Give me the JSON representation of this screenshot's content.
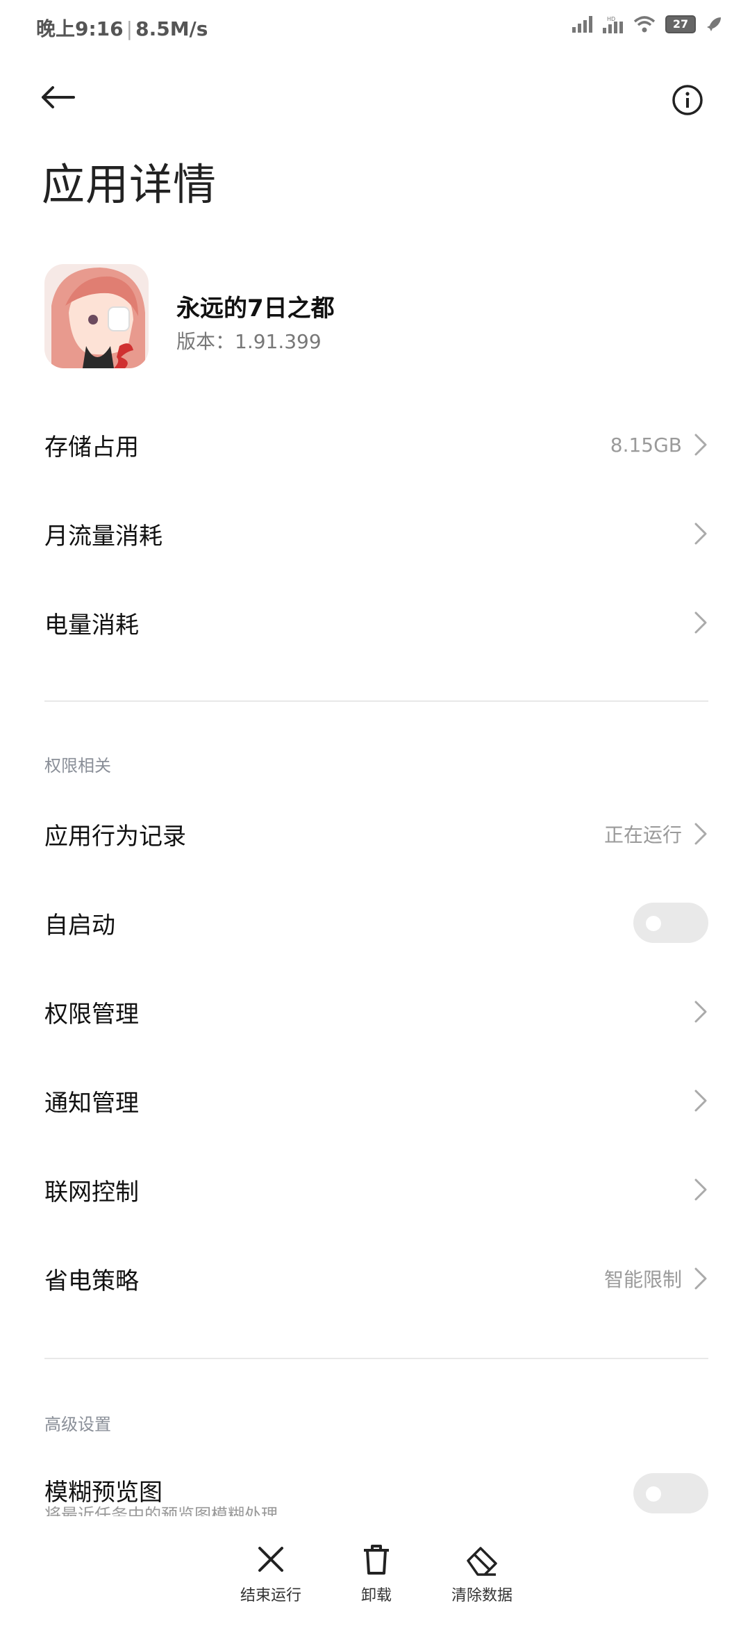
{
  "status_bar": {
    "time": "晚上9:16",
    "speed": "8.5M/s",
    "battery": "27"
  },
  "header": {
    "title": "应用详情"
  },
  "app": {
    "name": "永远的7日之都",
    "version": "版本：1.91.399"
  },
  "usage": [
    {
      "label": "存储占用",
      "value": "8.15GB"
    },
    {
      "label": "月流量消耗",
      "value": ""
    },
    {
      "label": "电量消耗",
      "value": ""
    }
  ],
  "permissions_section": {
    "title": "权限相关",
    "items": [
      {
        "label": "应用行为记录",
        "value": "正在运行"
      },
      {
        "label": "自启动",
        "toggle": false
      },
      {
        "label": "权限管理",
        "value": ""
      },
      {
        "label": "通知管理",
        "value": ""
      },
      {
        "label": "联网控制",
        "value": ""
      },
      {
        "label": "省电策略",
        "value": "智能限制"
      }
    ]
  },
  "advanced_section": {
    "title": "高级设置",
    "items": [
      {
        "label": "模糊预览图",
        "sub": "将最近任务中的预览图模糊处理",
        "toggle": false
      }
    ]
  },
  "bottom_actions": [
    {
      "label": "结束运行",
      "icon": "close-icon"
    },
    {
      "label": "卸载",
      "icon": "trash-icon"
    },
    {
      "label": "清除数据",
      "icon": "eraser-icon"
    }
  ],
  "colors": {
    "text_primary": "#111111",
    "text_secondary": "#9a9a9a",
    "toggle_off": "#e9e9e9",
    "divider": "#e8e8e8"
  }
}
